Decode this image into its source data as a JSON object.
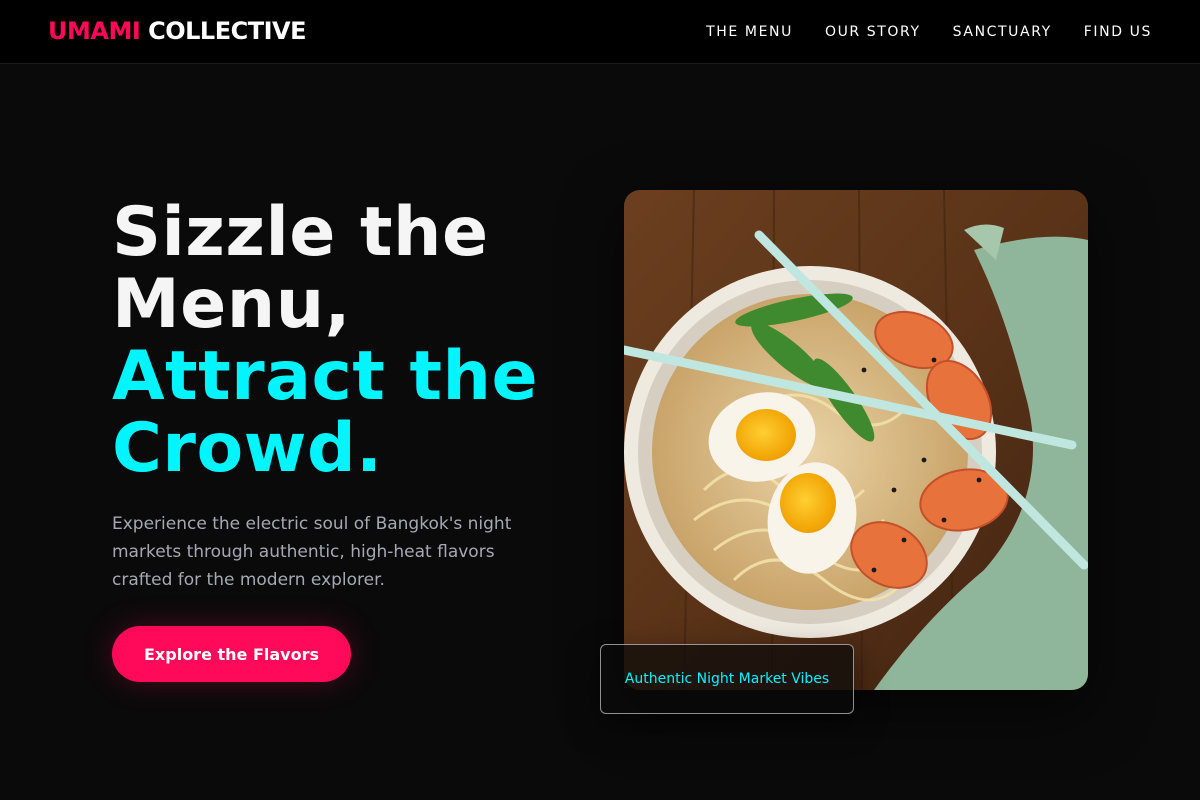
{
  "brand": {
    "accent_text": "UMAMI",
    "rest_text": "COLLECTIVE",
    "accent_color": "#ff0a5a"
  },
  "nav": {
    "items": [
      {
        "label": "THE MENU"
      },
      {
        "label": "OUR STORY"
      },
      {
        "label": "SANCTUARY"
      },
      {
        "label": "FIND US"
      }
    ]
  },
  "hero": {
    "headline_line1": "Sizzle the",
    "headline_line2": "Menu,",
    "headline_line3": "Attract the",
    "headline_line4": "Crowd.",
    "highlight_color": "#00f5ff",
    "subtitle": "Experience the electric soul of Bangkok's night markets through authentic, high-heat flavors crafted for the modern explorer.",
    "cta_label": "Explore the Flavors",
    "image_icon": "ramen-bowl-photo",
    "badge_text": "Authentic Night Market Vibes"
  }
}
